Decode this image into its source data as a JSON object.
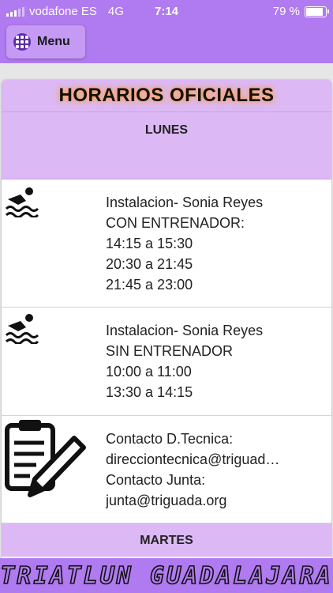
{
  "status": {
    "carrier": "vodafone ES",
    "network": "4G",
    "time": "7:14",
    "battery": "79 %",
    "battery_level": 0.79
  },
  "header": {
    "menu_label": "Menu"
  },
  "page": {
    "title": "HORARIOS OFICIALES",
    "days": [
      "LUNES",
      "MARTES"
    ],
    "items": [
      {
        "icon": "swimmer-icon",
        "lines": [
          "Instalacion- Sonia Reyes",
          "CON ENTRENADOR:",
          "14:15 a 15:30",
          "20:30 a 21:45",
          "21:45 a 23:00"
        ]
      },
      {
        "icon": "swimmer-icon",
        "lines": [
          "Instalacion- Sonia Reyes",
          "SIN ENTRENADOR",
          "10:00 a 11:00",
          "13:30 a 14:15"
        ]
      },
      {
        "icon": "clipboard-pencil-icon",
        "lines": [
          "Contacto D.Tecnica:",
          "direcciontecnica@triguad…",
          "Contacto Junta:",
          "junta@triguada.org"
        ]
      }
    ]
  },
  "footer": {
    "banner": "TRIATLUN GUADALAJARA"
  },
  "colors": {
    "accent": "#b07af0",
    "row": "#dcb8f5",
    "glow": "#ff9a30"
  }
}
